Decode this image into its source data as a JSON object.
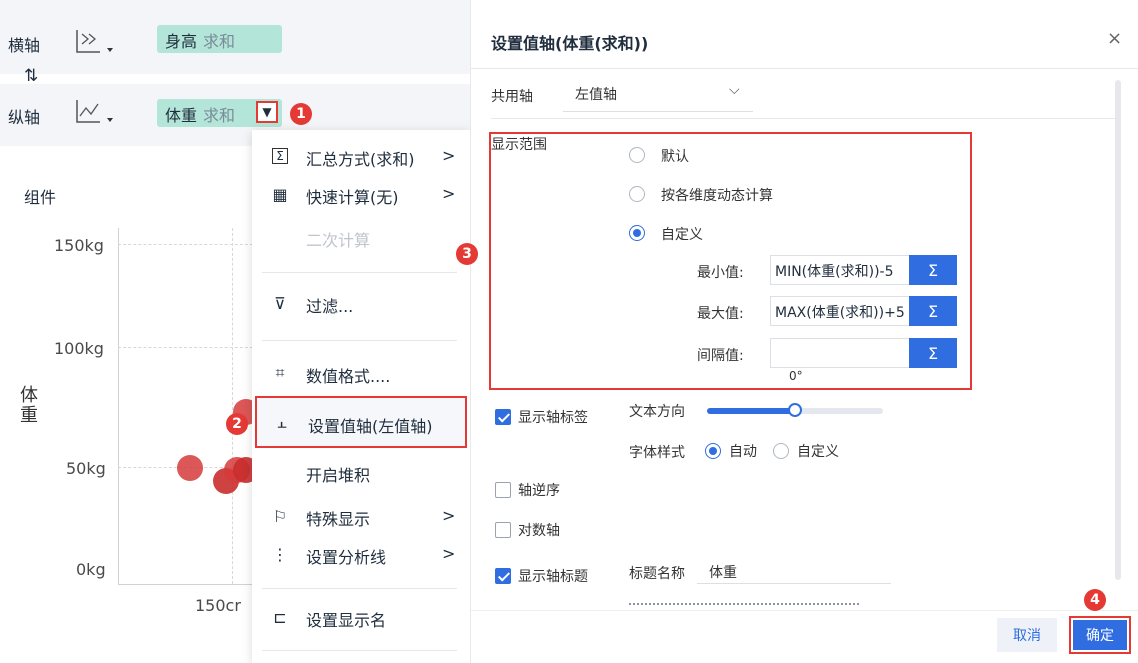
{
  "axes": {
    "x_label": "横轴",
    "y_label": "纵轴",
    "swap_icon": "swap-vertical-icon",
    "x_field": {
      "name": "身高",
      "agg": "求和"
    },
    "y_field": {
      "name": "体重",
      "agg": "求和"
    }
  },
  "chart": {
    "component_label": "组件",
    "y_axis_title": "体重",
    "y_ticks": [
      "150kg",
      "100kg",
      "50kg",
      "0kg"
    ],
    "x_tick": "150cr"
  },
  "menu": {
    "items": [
      {
        "icon": "Σ",
        "label": "汇总方式(求和)",
        "arrow": ">"
      },
      {
        "icon": "▦",
        "label": "快速计算(无)",
        "arrow": ">"
      },
      {
        "icon": "",
        "label": "二次计算",
        "arrow": ""
      },
      {
        "icon": "⊽",
        "label": "过滤...",
        "arrow": ""
      },
      {
        "icon": "⌗",
        "label": "数值格式....",
        "arrow": ""
      },
      {
        "icon": "⫠",
        "label": "设置值轴(左值轴)",
        "arrow": ""
      },
      {
        "icon": "",
        "label": "开启堆积",
        "arrow": ""
      },
      {
        "icon": "⚐",
        "label": "特殊显示",
        "arrow": ">"
      },
      {
        "icon": "⋮",
        "label": "设置分析线",
        "arrow": ">"
      },
      {
        "icon": "⊏",
        "label": "设置显示名",
        "arrow": ""
      }
    ]
  },
  "badges": [
    "1",
    "2",
    "3",
    "4"
  ],
  "dialog": {
    "title": "设置值轴(体重(求和))",
    "close": "×",
    "shared_axis_label": "共用轴",
    "shared_axis_value": "左值轴",
    "range_label": "显示范围",
    "options": [
      "默认",
      "按各维度动态计算",
      "自定义"
    ],
    "min_label": "最小值:",
    "min_value": "MIN(体重(求和))-5",
    "max_label": "最大值:",
    "max_value": "MAX(体重(求和))+5",
    "interval_label": "间隔值:",
    "interval_value": "",
    "sigma": "Σ",
    "show_axis_label": "显示轴标签",
    "text_direction_label": "文本方向",
    "text_direction_value": "0°",
    "text_direction_fraction": 0.5,
    "font_style_label": "字体样式",
    "font_auto": "自动",
    "font_custom": "自定义",
    "reverse_axis": "轴逆序",
    "log_axis": "对数轴",
    "show_axis_title": "显示轴标题",
    "title_name_label": "标题名称",
    "title_name_value": "体重",
    "cancel": "取消",
    "confirm": "确定"
  },
  "colors": {
    "accent": "#2f6de1",
    "highlight": "#e53935",
    "pill": "#b3e5d8",
    "point": "#d63a3a"
  }
}
